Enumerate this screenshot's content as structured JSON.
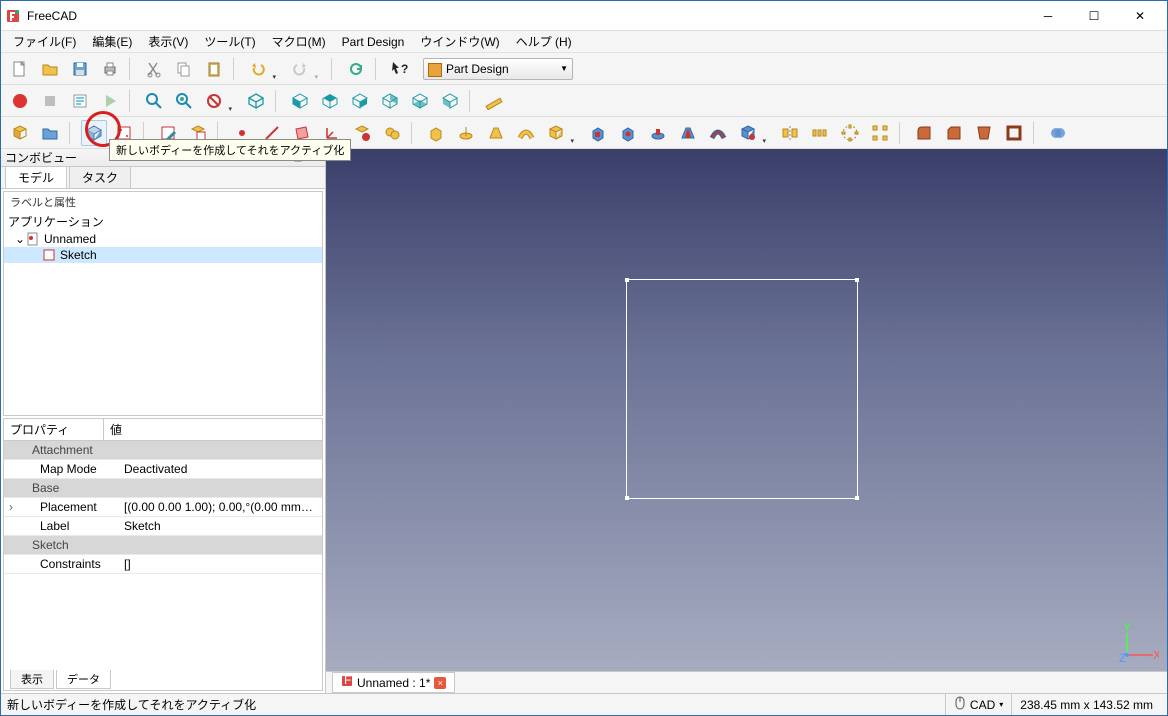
{
  "title": "FreeCAD",
  "menu": {
    "file": "ファイル(F)",
    "edit": "編集(E)",
    "view": "表示(V)",
    "tools": "ツール(T)",
    "macro": "マクロ(M)",
    "partdesign": "Part Design",
    "window": "ウインドウ(W)",
    "help": "ヘルプ (H)"
  },
  "workbench": "Part Design",
  "tooltip_createbody": "新しいボディーを作成してそれをアクティブ化",
  "panel": {
    "title": "コンボビュー",
    "tab_model": "モデル",
    "tab_task": "タスク"
  },
  "tree": {
    "labels_header": "ラベルと属性",
    "app": "アプリケーション",
    "doc": "Unnamed",
    "sketch": "Sketch"
  },
  "props": {
    "col1": "プロパティ",
    "col2": "値",
    "g_attachment": "Attachment",
    "mapmode_k": "Map Mode",
    "mapmode_v": "Deactivated",
    "g_base": "Base",
    "placement_k": "Placement",
    "placement_v": "[(0.00 0.00 1.00); 0.00,°(0.00 mm  0.0...",
    "label_k": "Label",
    "label_v": "Sketch",
    "g_sketch": "Sketch",
    "constraints_k": "Constraints",
    "constraints_v": "[]",
    "tab_view": "表示",
    "tab_data": "データ"
  },
  "doc_tab": "Unnamed : 1*",
  "status": {
    "hint": "新しいボディーを作成してそれをアクティブ化",
    "cad": "CAD",
    "dims": "238.45 mm x 143.52 mm"
  }
}
